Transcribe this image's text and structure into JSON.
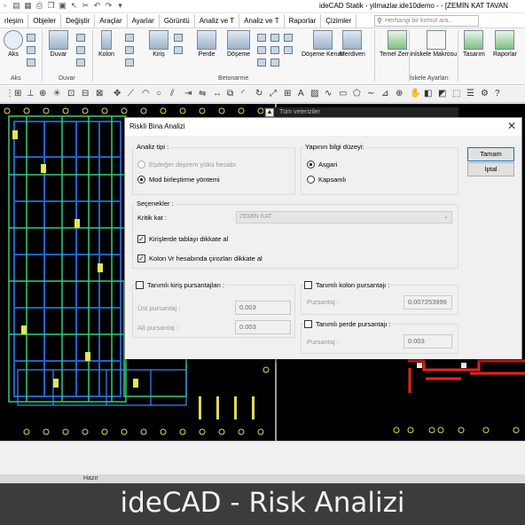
{
  "app_title": "ideCAD Statik - yilmazlar.ide10demo - - [ZEMİN KAT TAVAN",
  "menu_tabs": [
    "rleşim",
    "Objeler",
    "Değiştir",
    "Araçlar",
    "Ayarlar",
    "Görüntü",
    "Analiz ve T",
    "Analiz ve T",
    "Raporlar",
    "Çizimler"
  ],
  "search_placeholder": "Herhangi bir komut ara...",
  "ribbon": {
    "buttons": [
      "Aks",
      "Duvar",
      "Kolon",
      "Kiriş",
      "Perde",
      "Döşeme",
      "Döşeme Kenarı",
      "Merdiven",
      "Temel Zemin",
      "İskele Makrosu",
      "Tasarım",
      "Raporlar"
    ],
    "groups": [
      "Aks",
      "Duvar",
      "Betonarme",
      "İskele Ayarları"
    ]
  },
  "command_hint": "Tüm veteriziler",
  "status": "Hazır",
  "caption": "ideCAD - Risk Analizi",
  "dialog": {
    "title": "Riskli Bina Analizi",
    "analysis_type": {
      "label": "Analiz tipi :",
      "options": [
        "Eşdeğer deprem yükü hesabı",
        "Mod birleştirme yöntemi"
      ]
    },
    "knowledge_level": {
      "label": "Yapının bilgi düzeyi:",
      "options": [
        "Asgari",
        "Kapsamlı"
      ]
    },
    "options_group": {
      "label": "Seçenekler :",
      "critical_floor_label": "Kritik kat :",
      "critical_floor_value": "ZEMİN KAT",
      "beam_check": "Kirişlerde tablayı dikkate al",
      "column_check": "Kolon Vr hesabında çirozları dikkate al"
    },
    "beam_allowance": {
      "label": "Tanımlı kiriş pursantajları :",
      "top_label": "Üst pursantaj :",
      "top_value": "0.003",
      "bottom_label": "Alt pursantaj :",
      "bottom_value": "0.003"
    },
    "column_allowance": {
      "label": "Tanımlı kolon pursantajı :",
      "value_label": "Pursantaj :",
      "value": "0.007253999"
    },
    "wall_allowance": {
      "label": "Tanımlı perde pursantajı :",
      "value_label": "Pursantaj :",
      "value": "0.003"
    },
    "ok_label": "Tamam",
    "cancel_label": "İptal"
  }
}
